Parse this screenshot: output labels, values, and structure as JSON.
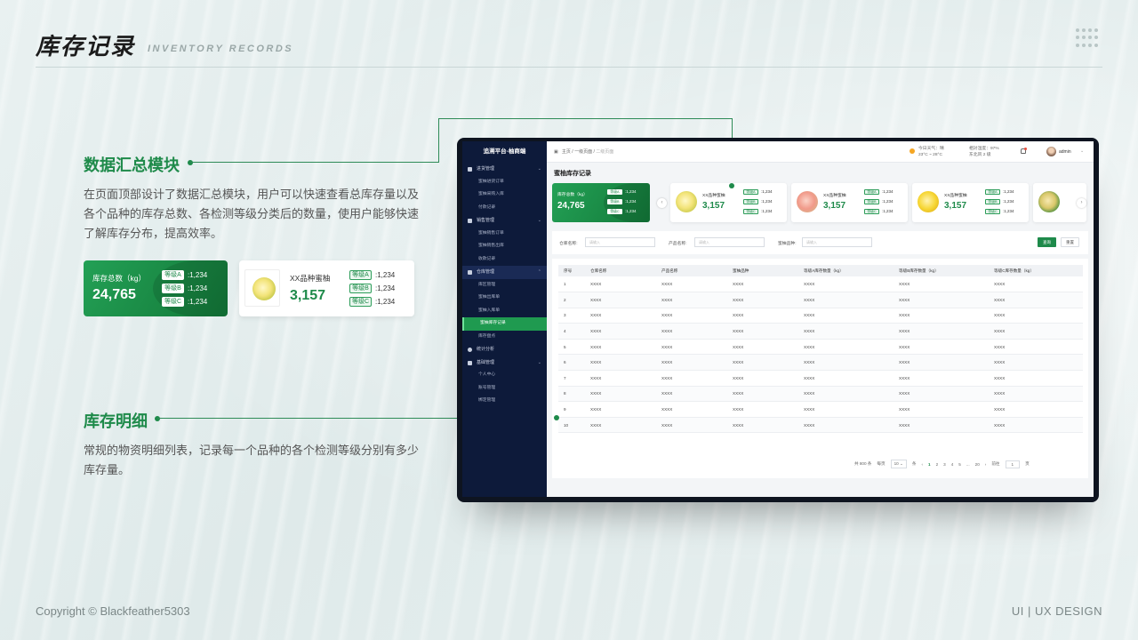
{
  "header": {
    "title": "库存记录",
    "subtitle": "INVENTORY RECORDS"
  },
  "sections": {
    "summary": {
      "title": "数据汇总模块",
      "desc": "在页面顶部设计了数据汇总模块，用户可以快速查看总库存量以及各个品种的库存总数、各检测等级分类后的数量，使用户能够快速了解库存分布，提高效率。"
    },
    "detail": {
      "title": "库存明细",
      "desc": "常规的物资明细列表，记录每一个品种的各个检测等级分别有多少库存量。"
    }
  },
  "total_card": {
    "label": "库存总数（kg）",
    "value": "24,765",
    "grades": [
      {
        "tag": "等级A",
        "val": ":1,234"
      },
      {
        "tag": "等级B",
        "val": ":1,234"
      },
      {
        "tag": "等级C",
        "val": ":1,234"
      }
    ]
  },
  "product_card": {
    "name": "XX品种蜜柚",
    "value": "3,157",
    "grades": [
      {
        "tag": "等级A",
        "val": ":1,234"
      },
      {
        "tag": "等级B",
        "val": ":1,234"
      },
      {
        "tag": "等级C",
        "val": ":1,234"
      }
    ]
  },
  "app": {
    "brand": "追溯平台-柚商端",
    "sidebar": [
      {
        "group": "进货管理",
        "items": [
          "蜜柚进货订单",
          "蜜柚采购入库",
          "付款记录"
        ]
      },
      {
        "group": "销售管理",
        "items": [
          "蜜柚销售订单",
          "蜜柚销售出库",
          "收款记录"
        ]
      },
      {
        "group": "仓库管理",
        "items": [
          "库区管理",
          "蜜柚出库单",
          "蜜柚入库单",
          "蜜柚库存记录",
          "库存盘点"
        ]
      },
      {
        "group": "统计分析",
        "items": []
      },
      {
        "group": "基础管理",
        "items": [
          "个人中心",
          "账号管理",
          "绑定管理"
        ]
      }
    ],
    "breadcrumb": {
      "b1": "主页",
      "b2": "一级页面",
      "b3": "二级页面"
    },
    "weather": {
      "line1": "今日天气：晴",
      "line2": "23°C ~ 28°C",
      "line3": "相对湿度：97%",
      "line4": "东北风 2 级"
    },
    "user": "admin",
    "page_title": "蜜柚库存记录",
    "mini_total": {
      "label": "库存总数（kg）",
      "value": "24,765",
      "grades": [
        ":1,234",
        ":1,234",
        ":1,234"
      ]
    },
    "mini_cards": [
      {
        "name": "XX品种蜜柚",
        "value": "3,157"
      },
      {
        "name": "XX品种蜜柚",
        "value": "3,157"
      },
      {
        "name": "XX品种蜜柚",
        "value": "3,157"
      }
    ],
    "grade_tags": [
      "等级A",
      "等级B",
      "等级C"
    ],
    "grade_val": ":1,234",
    "search": {
      "warehouse_label": "仓库名称:",
      "product_label": "产品名称:",
      "variety_label": "蜜柚品种:",
      "placeholder": "请输入",
      "query": "查询",
      "reset": "重置"
    },
    "table": {
      "headers": [
        "序号",
        "仓库名称",
        "产品名称",
        "蜜柚品种",
        "等级A库存数量（kg）",
        "等级B库存数量（kg）",
        "等级C库存数量（kg）"
      ],
      "rows": [
        [
          "1",
          "XXXX",
          "XXXX",
          "XXXX",
          "XXXX",
          "XXXX",
          "XXXX"
        ],
        [
          "2",
          "XXXX",
          "XXXX",
          "XXXX",
          "XXXX",
          "XXXX",
          "XXXX"
        ],
        [
          "3",
          "XXXX",
          "XXXX",
          "XXXX",
          "XXXX",
          "XXXX",
          "XXXX"
        ],
        [
          "4",
          "XXXX",
          "XXXX",
          "XXXX",
          "XXXX",
          "XXXX",
          "XXXX"
        ],
        [
          "5",
          "XXXX",
          "XXXX",
          "XXXX",
          "XXXX",
          "XXXX",
          "XXXX"
        ],
        [
          "6",
          "XXXX",
          "XXXX",
          "XXXX",
          "XXXX",
          "XXXX",
          "XXXX"
        ],
        [
          "7",
          "XXXX",
          "XXXX",
          "XXXX",
          "XXXX",
          "XXXX",
          "XXXX"
        ],
        [
          "8",
          "XXXX",
          "XXXX",
          "XXXX",
          "XXXX",
          "XXXX",
          "XXXX"
        ],
        [
          "9",
          "XXXX",
          "XXXX",
          "XXXX",
          "XXXX",
          "XXXX",
          "XXXX"
        ],
        [
          "10",
          "XXXX",
          "XXXX",
          "XXXX",
          "XXXX",
          "XXXX",
          "XXXX"
        ]
      ]
    },
    "pager": {
      "total": "共 800 条",
      "per": "每页",
      "size": "10",
      "unit": "条",
      "pages": [
        "1",
        "2",
        "3",
        "4",
        "5",
        "...",
        "20"
      ],
      "prev": "‹",
      "next": "›",
      "goto": "前往",
      "goto_val": "1",
      "page_unit": "页"
    }
  },
  "footer": {
    "copyright": "Copyright © Blackfeather5303",
    "tag": "UI | UX DESIGN"
  },
  "colors": {
    "accent": "#1e8a4a",
    "sidebar": "#0d1a3a"
  },
  "icons": [
    "dots-grid-icon",
    "pomelo-icon",
    "sun-icon",
    "bell-icon",
    "chevron-left-icon",
    "chevron-right-icon"
  ]
}
